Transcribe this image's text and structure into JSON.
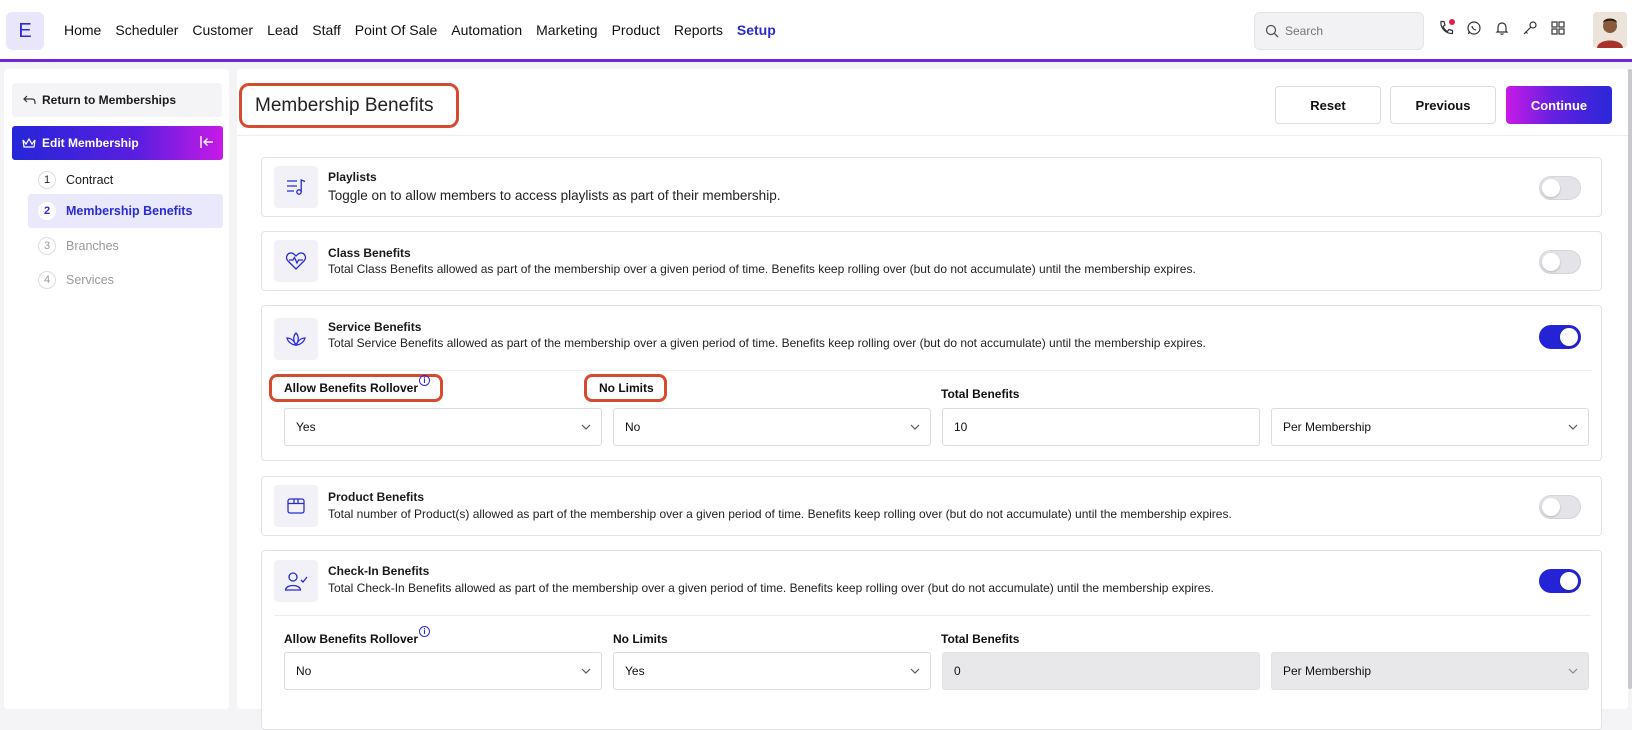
{
  "logo": "E",
  "nav": [
    "Home",
    "Scheduler",
    "Customer",
    "Lead",
    "Staff",
    "Point Of Sale",
    "Automation",
    "Marketing",
    "Product",
    "Reports",
    "Setup"
  ],
  "search": {
    "placeholder": "Search"
  },
  "sidebar": {
    "back_label": "Return to Memberships",
    "section_title": "Edit Membership",
    "steps": [
      {
        "num": "1",
        "label": "Contract"
      },
      {
        "num": "2",
        "label": "Membership Benefits"
      },
      {
        "num": "3",
        "label": "Branches"
      },
      {
        "num": "4",
        "label": "Services"
      }
    ]
  },
  "page": {
    "title": "Membership Benefits",
    "reset": "Reset",
    "previous": "Previous",
    "continue": "Continue"
  },
  "cards": {
    "playlists": {
      "title": "Playlists",
      "desc": "Toggle on to allow members to access playlists as part of their membership.",
      "enabled": false
    },
    "class": {
      "title": "Class Benefits",
      "desc": "Total Class Benefits allowed as part of the membership over a given period of time. Benefits keep rolling over (but do not accumulate) until the membership expires.",
      "enabled": false
    },
    "service": {
      "title": "Service Benefits",
      "desc": "Total Service Benefits allowed as part of the membership over a given period of time. Benefits keep rolling over (but do not accumulate) until the membership expires.",
      "enabled": true,
      "rollover_label": "Allow Benefits Rollover",
      "rollover_value": "Yes",
      "nolimits_label": "No Limits",
      "nolimits_value": "No",
      "total_label": "Total Benefits",
      "total_value": "10",
      "period_value": "Per Membership"
    },
    "product": {
      "title": "Product Benefits",
      "desc": "Total number of Product(s) allowed as part of the membership over a given period of time. Benefits keep rolling over (but do not accumulate) until the membership expires.",
      "enabled": false
    },
    "checkin": {
      "title": "Check-In Benefits",
      "desc": "Total Check-In Benefits allowed as part of the membership over a given period of time. Benefits keep rolling over (but do not accumulate) until the membership expires.",
      "enabled": true,
      "rollover_label": "Allow Benefits Rollover",
      "rollover_value": "No",
      "nolimits_label": "No Limits",
      "nolimits_value": "Yes",
      "total_label": "Total Benefits",
      "total_value": "0",
      "period_value": "Per Membership"
    }
  },
  "colors": {
    "accent": "#2b2bd6",
    "highlight": "#d64a2f"
  }
}
